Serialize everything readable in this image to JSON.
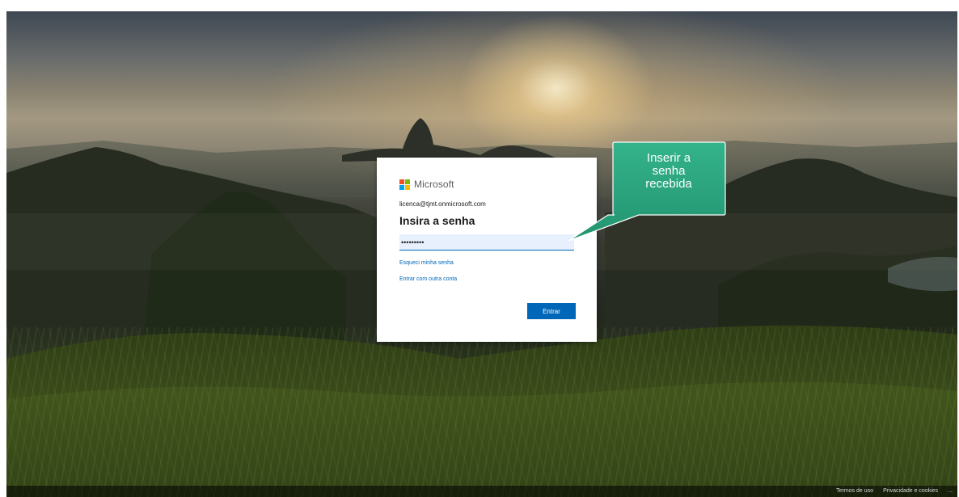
{
  "login": {
    "brand": "Microsoft",
    "identity": "licenca@tjmt.onmicrosoft.com",
    "title": "Insira a senha",
    "password_value": "•••••••••",
    "forgot_password": "Esqueci minha senha",
    "other_account": "Entrar com outra conta",
    "submit": "Entrar"
  },
  "callout": {
    "lines": [
      "Inserir a",
      "senha",
      "recebida"
    ],
    "color": "#2aa37e"
  },
  "footer": {
    "terms": "Termos de uso",
    "privacy": "Privacidade e cookies",
    "more": "..."
  },
  "colors": {
    "accent": "#0067b8",
    "logo_red": "#f25022",
    "logo_green": "#7fba00",
    "logo_blue": "#00a4ef",
    "logo_yellow": "#ffb900"
  }
}
